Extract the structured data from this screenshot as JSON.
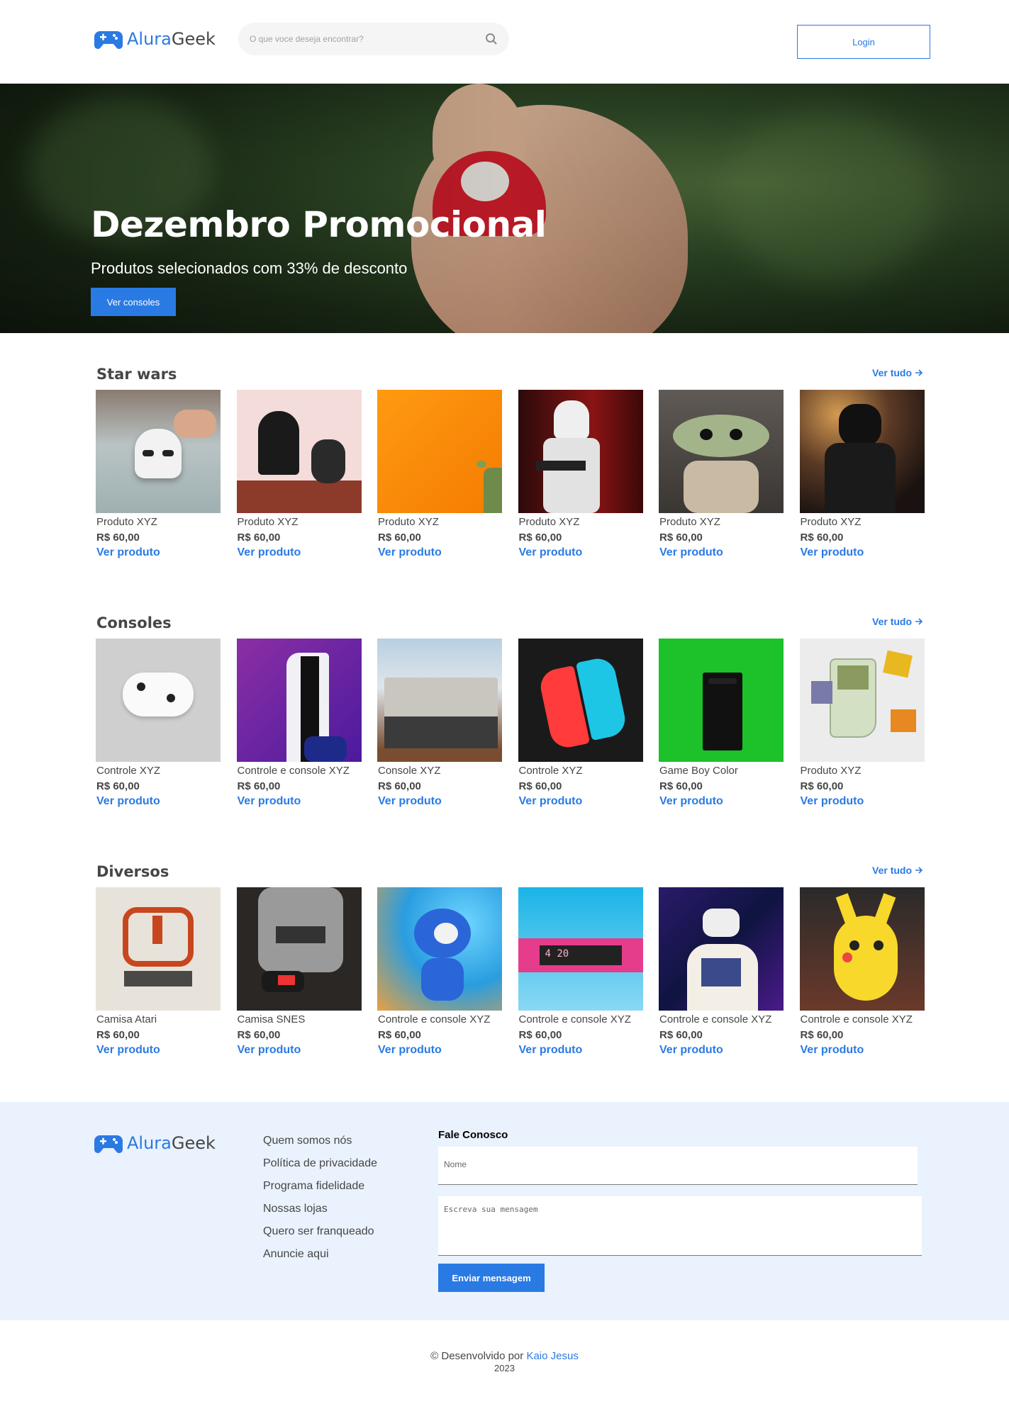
{
  "brand": {
    "part1": "Alura",
    "part2": "Geek"
  },
  "search": {
    "placeholder": "O que voce deseja encontrar?"
  },
  "header": {
    "login_label": "Login"
  },
  "hero": {
    "title": "Dezembro Promocional",
    "subtitle": "Produtos selecionados com 33% de desconto",
    "cta_label": "Ver consoles"
  },
  "sections": [
    {
      "title": "Star wars",
      "see_all": "Ver tudo",
      "products": [
        {
          "name": "Produto XYZ",
          "price": "R$ 60,00",
          "link": "Ver produto",
          "image": "stormtrooper-mug"
        },
        {
          "name": "Produto XYZ",
          "price": "R$ 60,00",
          "link": "Ver produto",
          "image": "lego-helmets"
        },
        {
          "name": "Produto XYZ",
          "price": "R$ 60,00",
          "link": "Ver produto",
          "image": "yoda-orange"
        },
        {
          "name": "Produto XYZ",
          "price": "R$ 60,00",
          "link": "Ver produto",
          "image": "stormtrooper-figure"
        },
        {
          "name": "Produto XYZ",
          "price": "R$ 60,00",
          "link": "Ver produto",
          "image": "baby-yoda"
        },
        {
          "name": "Produto XYZ",
          "price": "R$ 60,00",
          "link": "Ver produto",
          "image": "kylo-ren"
        }
      ]
    },
    {
      "title": "Consoles",
      "see_all": "Ver tudo",
      "products": [
        {
          "name": "Controle XYZ",
          "price": "R$ 60,00",
          "link": "Ver produto",
          "image": "xbox-controller"
        },
        {
          "name": "Controle e console XYZ",
          "price": "R$ 60,00",
          "link": "Ver produto",
          "image": "ps5"
        },
        {
          "name": "Console XYZ",
          "price": "R$ 60,00",
          "link": "Ver produto",
          "image": "nes"
        },
        {
          "name": "Controle XYZ",
          "price": "R$ 60,00",
          "link": "Ver produto",
          "image": "joycon"
        },
        {
          "name": "Game Boy Color",
          "price": "R$ 60,00",
          "link": "Ver produto",
          "image": "xbox-series"
        },
        {
          "name": "Produto XYZ",
          "price": "R$ 60,00",
          "link": "Ver produto",
          "image": "gameboy"
        }
      ]
    },
    {
      "title": "Diversos",
      "see_all": "Ver tudo",
      "products": [
        {
          "name": "Camisa Atari",
          "price": "R$ 60,00",
          "link": "Ver produto",
          "image": "atari-shirt"
        },
        {
          "name": "Camisa SNES",
          "price": "R$ 60,00",
          "link": "Ver produto",
          "image": "snes-shirt"
        },
        {
          "name": "Controle e console XYZ",
          "price": "R$ 60,00",
          "link": "Ver produto",
          "image": "sonic"
        },
        {
          "name": "Controle e console XYZ",
          "price": "R$ 60,00",
          "link": "Ver produto",
          "image": "clock"
        },
        {
          "name": "Controle e console XYZ",
          "price": "R$ 60,00",
          "link": "Ver produto",
          "image": "vr-headset"
        },
        {
          "name": "Controle e console XYZ",
          "price": "R$ 60,00",
          "link": "Ver produto",
          "image": "pikachu"
        }
      ]
    }
  ],
  "footer": {
    "links": [
      "Quem somos nós",
      "Política de privacidade",
      "Programa fidelidade",
      "Nossas lojas",
      "Quero ser franqueado",
      "Anuncie aqui"
    ],
    "contact_title": "Fale Conosco",
    "name_placeholder": "Nome",
    "message_placeholder": "Escreva sua mensagem",
    "send_label": "Enviar mensagem"
  },
  "credits": {
    "prefix": "© Desenvolvido por",
    "author": "Kaio Jesus",
    "year": "2023"
  },
  "colors": {
    "accent": "#2A7AE4",
    "text": "#464646",
    "footer_bg": "#EAF2FD"
  }
}
